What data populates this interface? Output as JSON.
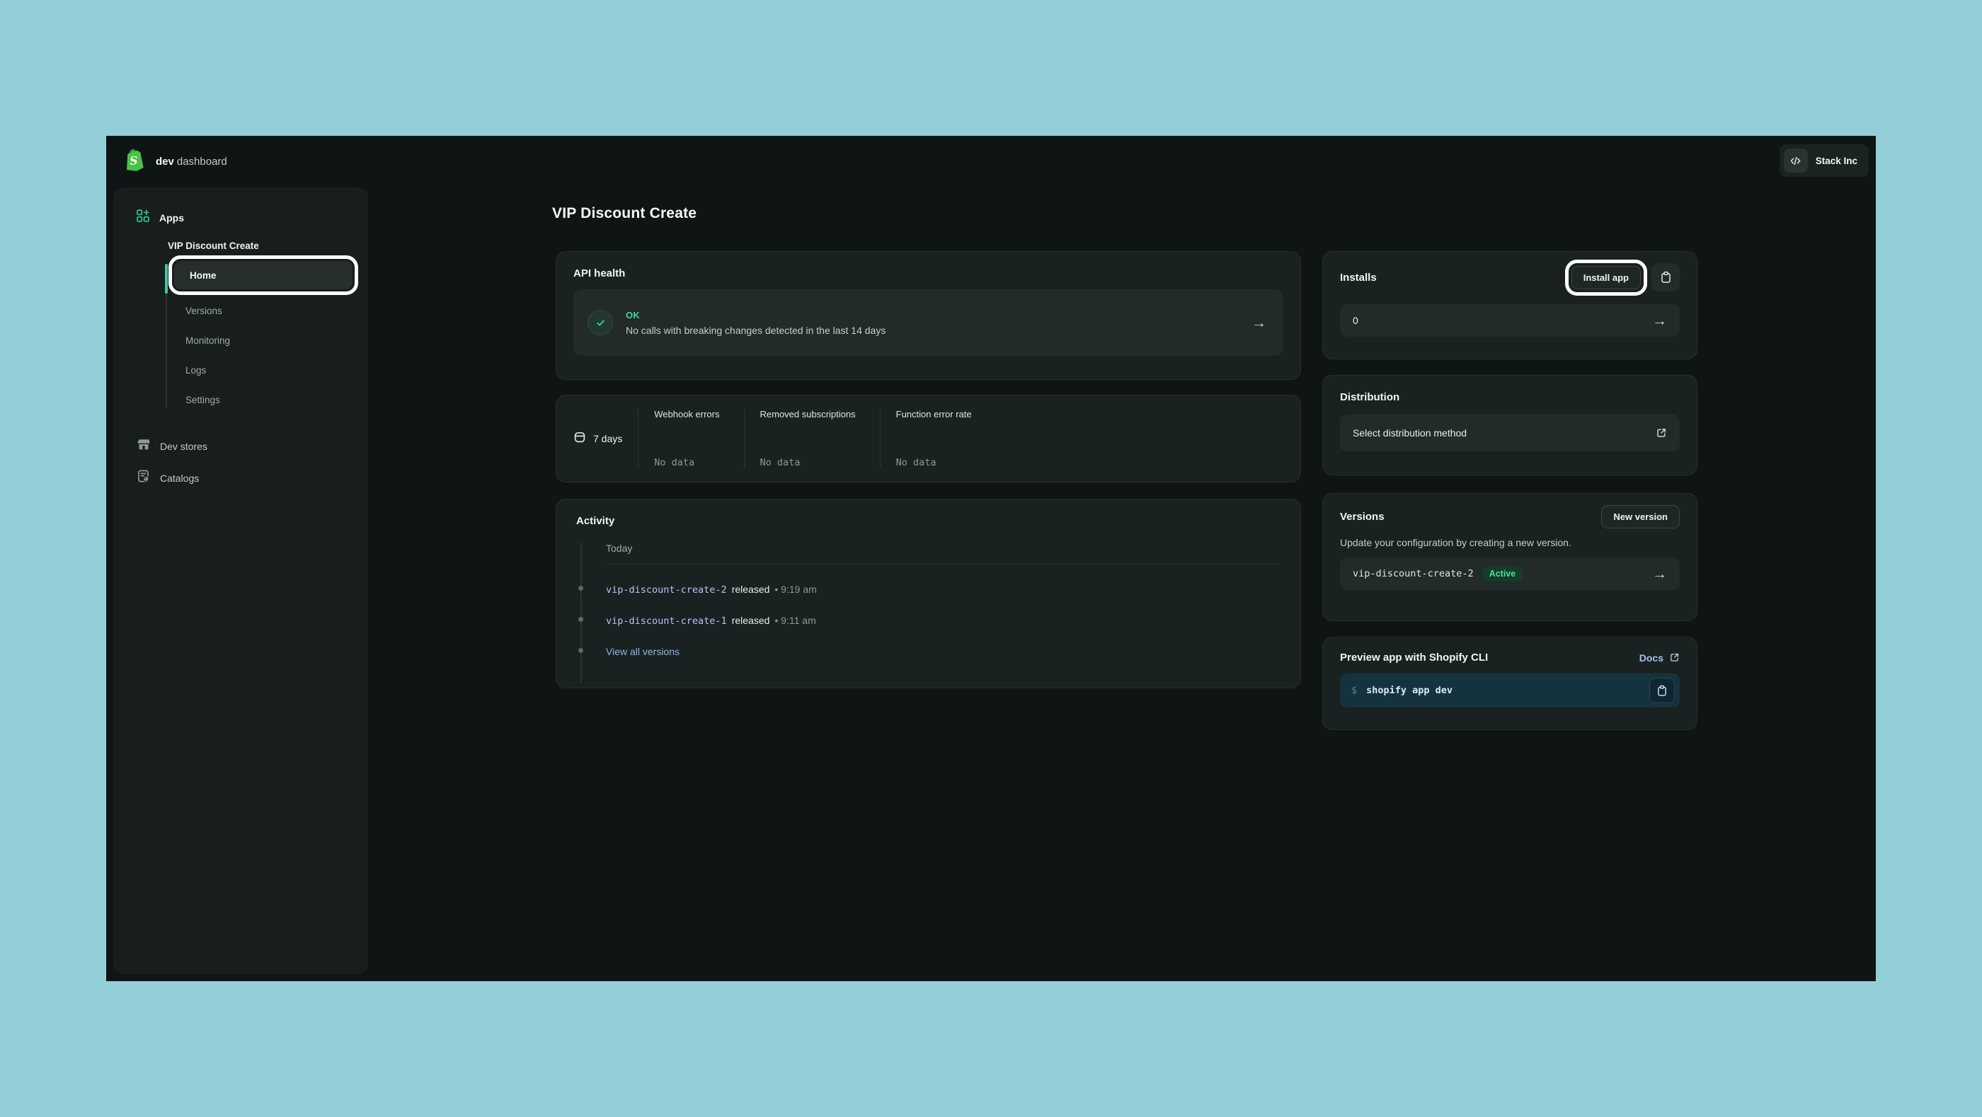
{
  "topbar": {
    "brand_bold": "dev",
    "brand_rest": "dashboard",
    "org": "Stack Inc"
  },
  "sidebar": {
    "apps_label": "Apps",
    "app_name": "VIP Discount Create",
    "nav": [
      "Home",
      "Versions",
      "Monitoring",
      "Logs",
      "Settings"
    ],
    "active_item": "Home",
    "dev_stores_label": "Dev stores",
    "catalogs_label": "Catalogs"
  },
  "main": {
    "title": "VIP Discount Create",
    "api_health": {
      "title": "API health",
      "status": "OK",
      "message": "No calls with breaking changes detected in the last 14 days"
    },
    "metrics": {
      "range": "7 days",
      "columns": [
        {
          "label": "Webhook errors",
          "value": "No data"
        },
        {
          "label": "Removed subscriptions",
          "value": "No data"
        },
        {
          "label": "Function error rate",
          "value": "No data"
        }
      ]
    },
    "activity": {
      "title": "Activity",
      "group": "Today",
      "items": [
        {
          "name": "vip-discount-create-2",
          "action": "released",
          "time": "• 9:19 am"
        },
        {
          "name": "vip-discount-create-1",
          "action": "released",
          "time": "• 9:11 am"
        }
      ],
      "link": "View all versions"
    }
  },
  "aside": {
    "installs": {
      "title": "Installs",
      "button": "Install app",
      "count": "0"
    },
    "distribution": {
      "title": "Distribution",
      "row": "Select distribution method"
    },
    "versions": {
      "title": "Versions",
      "button": "New version",
      "description": "Update your configuration by creating a new version.",
      "row_name": "vip-discount-create-2",
      "badge": "Active"
    },
    "preview": {
      "title": "Preview app with Shopify CLI",
      "docs": "Docs",
      "prompt": "$",
      "command": "shopify app dev"
    }
  },
  "colors": {
    "page_background": "#94ced6",
    "window_background": "#0f1515",
    "card_background": "#1a2121",
    "accent_green": "#3fd79b",
    "sidebar_active_bar": "#44c3a5",
    "badge_green": "#46e29b",
    "link_blue": "#8fb3e6",
    "version_link": "#b3c4f5",
    "cli_background": "#15333f",
    "focus_ring": "#ffffff",
    "shopify_logo_green": "#49c24a"
  }
}
